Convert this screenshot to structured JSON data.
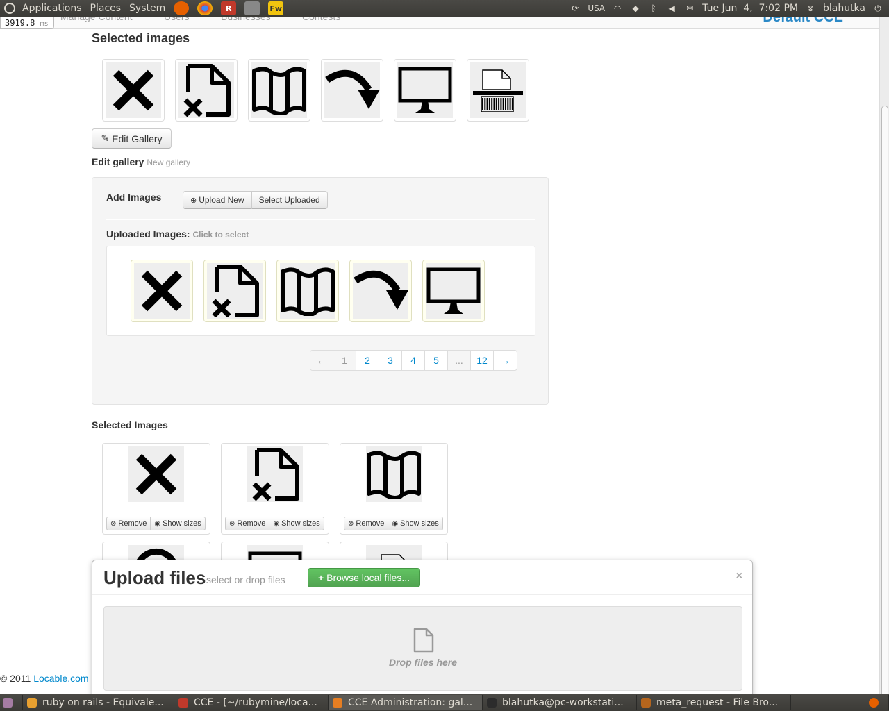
{
  "top_panel": {
    "menus": [
      "Applications",
      "Places",
      "System"
    ],
    "keyboard": "USA",
    "datetime": "Tue Jun  4,  7:02 PM",
    "user": "blahutka"
  },
  "page_header": {
    "nav_items": [
      "Manage Content",
      "Users",
      "Businesses",
      "Contests"
    ],
    "brand": "Default CCE"
  },
  "timer": {
    "value": "3919.8",
    "unit": "ms"
  },
  "selected_images_title": "Selected images",
  "selected_images": [
    "close-x",
    "file-delete",
    "map-book",
    "redo-arrow",
    "monitor",
    "shredder"
  ],
  "edit_gallery_button": "Edit Gallery",
  "edit_gallery": {
    "title": "Edit gallery",
    "subtitle": "New gallery"
  },
  "add_images": {
    "label": "Add Images",
    "upload_new": "Upload New",
    "select_uploaded": "Select Uploaded"
  },
  "uploaded": {
    "label": "Uploaded Images:",
    "hint": "Click to select",
    "images": [
      "close-x",
      "file-delete",
      "map-book",
      "redo-arrow",
      "monitor"
    ]
  },
  "pagination": [
    "←",
    "1",
    "2",
    "3",
    "4",
    "5",
    "...",
    "12",
    "→"
  ],
  "selected_images_lower": {
    "title": "Selected Images",
    "cards": [
      {
        "image": "close-x",
        "remove": "Remove",
        "show_sizes": "Show sizes"
      },
      {
        "image": "file-delete",
        "remove": "Remove",
        "show_sizes": "Show sizes"
      },
      {
        "image": "map-book",
        "remove": "Remove",
        "show_sizes": "Show sizes"
      }
    ]
  },
  "upload_modal": {
    "title": "Upload files",
    "subtitle": "select or drop files",
    "browse": "Browse local files...",
    "close": "×",
    "drop_text": "Drop files here"
  },
  "footer": {
    "copyright": "© 2011",
    "link": "Locable.com"
  },
  "taskbar": [
    {
      "label": "ruby on rails - Equivale...",
      "color": "#e8a030"
    },
    {
      "label": "CCE - [~/rubymine/loca...",
      "color": "#c0392b"
    },
    {
      "label": "CCE Administration: gal...",
      "color": "#e67e22"
    },
    {
      "label": "blahutka@pc-workstati...",
      "color": "#2c2c2c"
    },
    {
      "label": "meta_request - File Bro...",
      "color": "#b5651d"
    }
  ]
}
